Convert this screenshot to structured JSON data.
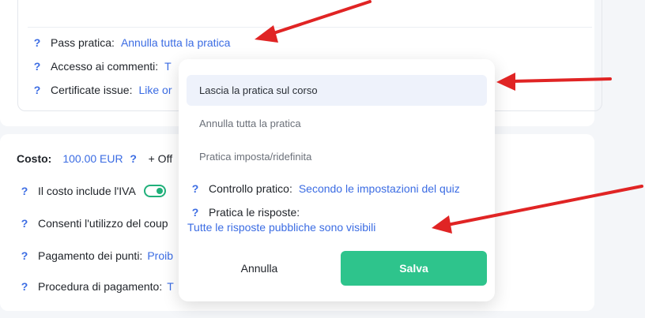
{
  "top_section": {
    "rows": [
      {
        "help": "?",
        "label": "Pass pratica:",
        "value": "Annulla tutta la pratica"
      },
      {
        "help": "?",
        "label": "Accesso ai commenti:",
        "value": "T"
      },
      {
        "help": "?",
        "label": "Certificate issue:",
        "value": "Like or"
      }
    ]
  },
  "pricing": {
    "cost_label": "Costo:",
    "cost_value": "100.00 EUR",
    "cost_help": "?",
    "offer_text": "+ Off",
    "rows": [
      {
        "help": "?",
        "label": "Il costo include l'IVA",
        "toggle": true
      },
      {
        "help": "?",
        "label": "Consenti l'utilizzo del coup"
      },
      {
        "help": "?",
        "label": "Pagamento dei punti:",
        "value": "Proib"
      },
      {
        "help": "?",
        "label": "Procedura di pagamento:",
        "value": "T"
      }
    ]
  },
  "modal": {
    "options": [
      {
        "label": "Lascia la pratica sul corso",
        "selected": true
      },
      {
        "label": "Annulla tutta la pratica",
        "selected": false
      },
      {
        "label": "Pratica imposta/ridefinita",
        "selected": false
      }
    ],
    "control_help": "?",
    "control_label": "Controllo pratico:",
    "control_value": "Secondo le impostazioni del quiz",
    "answers_help": "?",
    "answers_label": "Pratica le risposte:",
    "answers_value": "Tutte le risposte pubbliche sono visibili",
    "cancel_label": "Annulla",
    "save_label": "Salva"
  },
  "colors": {
    "accent_link": "#3b6ce3",
    "save_button": "#2ec48c",
    "toggle": "#20b07a",
    "annotation_arrow": "#e02424"
  }
}
